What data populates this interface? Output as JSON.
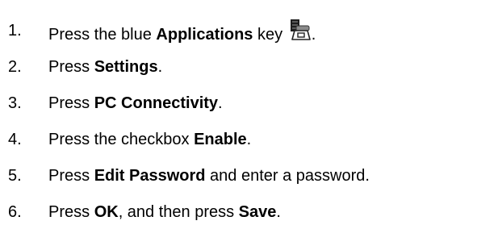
{
  "steps": [
    {
      "number": "1.",
      "parts": [
        {
          "text": "Press the blue ",
          "bold": false
        },
        {
          "text": "Applications",
          "bold": true
        },
        {
          "text": " key ",
          "bold": false
        },
        {
          "icon": "applications-key-icon"
        },
        {
          "text": ".",
          "bold": false
        }
      ]
    },
    {
      "number": "2.",
      "parts": [
        {
          "text": "Press ",
          "bold": false
        },
        {
          "text": "Settings",
          "bold": true
        },
        {
          "text": ".",
          "bold": false
        }
      ]
    },
    {
      "number": "3.",
      "parts": [
        {
          "text": "Press ",
          "bold": false
        },
        {
          "text": "PC Connectivity",
          "bold": true
        },
        {
          "text": ".",
          "bold": false
        }
      ]
    },
    {
      "number": "4.",
      "parts": [
        {
          "text": "Press the checkbox ",
          "bold": false
        },
        {
          "text": "Enable",
          "bold": true
        },
        {
          "text": ".",
          "bold": false
        }
      ]
    },
    {
      "number": "5.",
      "parts": [
        {
          "text": "Press ",
          "bold": false
        },
        {
          "text": "Edit Password",
          "bold": true
        },
        {
          "text": " and enter a password.",
          "bold": false
        }
      ]
    },
    {
      "number": "6.",
      "parts": [
        {
          "text": "Press ",
          "bold": false
        },
        {
          "text": "OK",
          "bold": true
        },
        {
          "text": ", and then press ",
          "bold": false
        },
        {
          "text": "Save",
          "bold": true
        },
        {
          "text": ".",
          "bold": false
        }
      ]
    }
  ]
}
